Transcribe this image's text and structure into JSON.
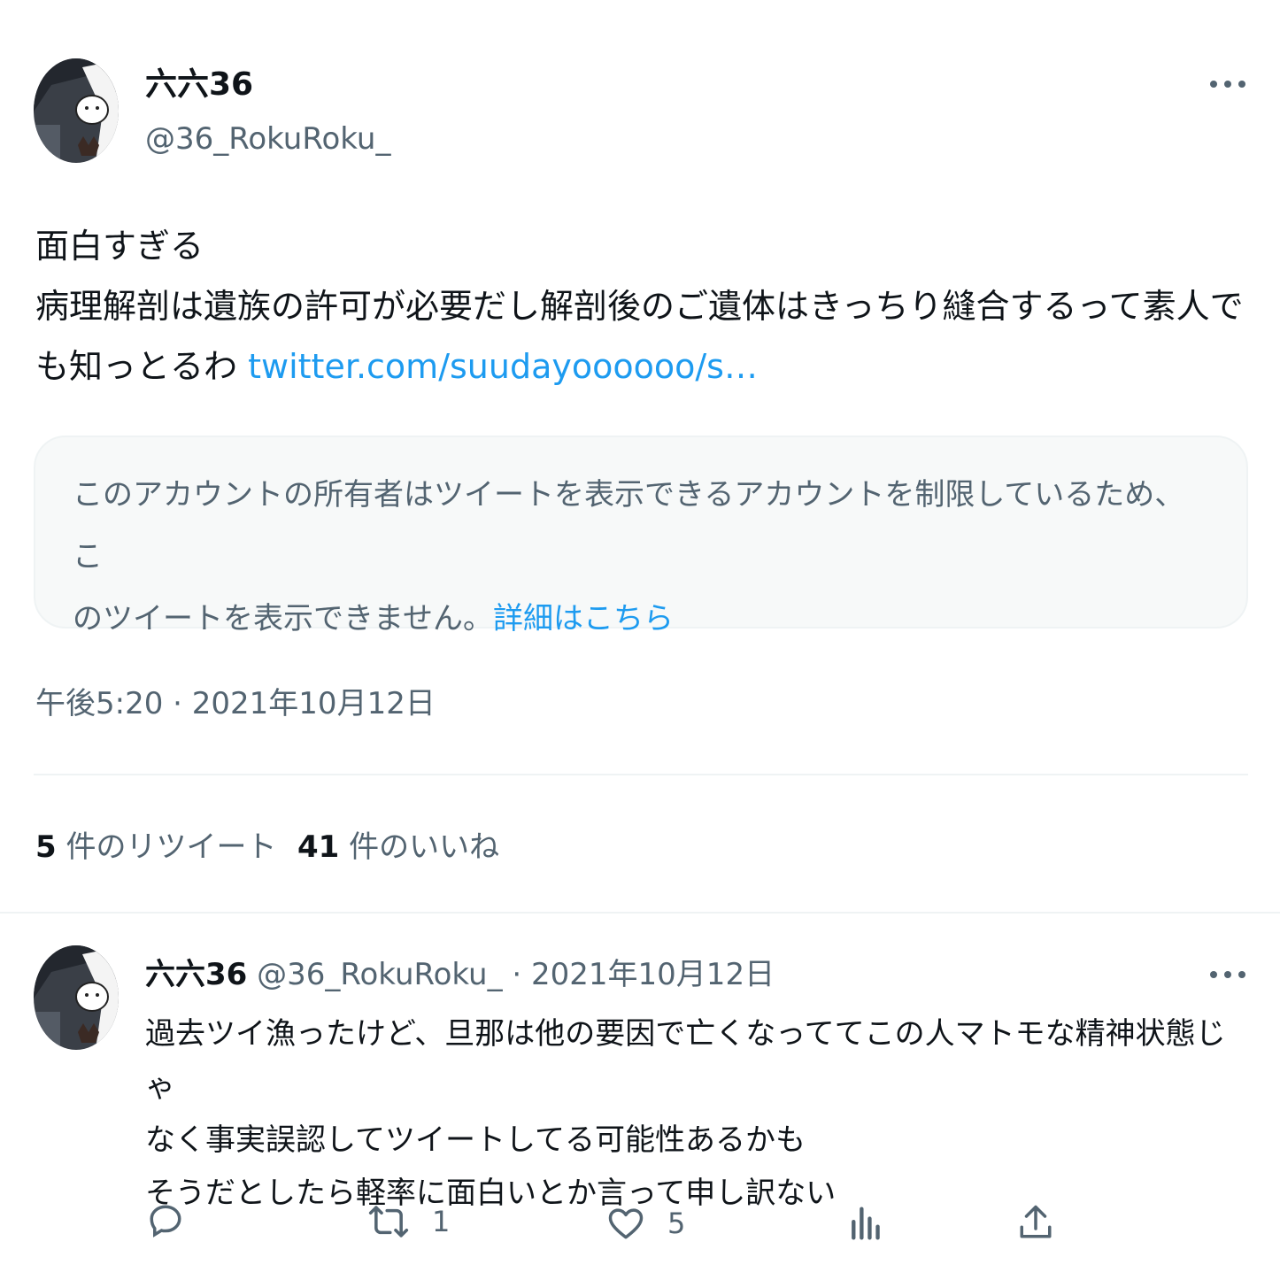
{
  "tweet": {
    "author": {
      "name": "六六36",
      "handle": "@36_RokuRoku_"
    },
    "text_line1": "面白すぎる",
    "text_line2": "病理解剖は遺族の許可が必要だし解剖後のご遺体はきっちり縫合するって素人で",
    "text_line3": "も知っとるわ",
    "link": "twitter.com/suudayoooooo/s…",
    "quoted_notice_line1": "このアカウントの所有者はツイートを表示できるアカウントを制限しているため、こ",
    "quoted_notice_line2": "のツイートを表示できません。",
    "quoted_notice_link": "詳細はこちら",
    "timestamp": "午後5:20 · 2021年10月12日",
    "retweets": {
      "count": "5",
      "label": "件のリツイート"
    },
    "likes": {
      "count": "41",
      "label": "件のいいね"
    }
  },
  "reply": {
    "author": {
      "name": "六六36",
      "handle": "@36_RokuRoku_"
    },
    "date": "· 2021年10月12日",
    "line1": "過去ツイ漁ったけど、旦那は他の要因で亡くなっててこの人マトモな精神状態じゃ",
    "line2": "なく事実誤認してツイートしてる可能性あるかも",
    "line3": "そうだとしたら軽率に面白いとか言って申し訳ない",
    "actions": {
      "retweet_count": "1",
      "like_count": "5"
    }
  },
  "colors": {
    "accent": "#1d9bf0",
    "secondary": "#536471",
    "text": "#0f1419",
    "card_bg": "#f7f9f9",
    "border": "#eff3f4"
  },
  "icons": [
    "more-icon",
    "reply-icon",
    "retweet-icon",
    "like-icon",
    "views-icon",
    "share-icon"
  ]
}
